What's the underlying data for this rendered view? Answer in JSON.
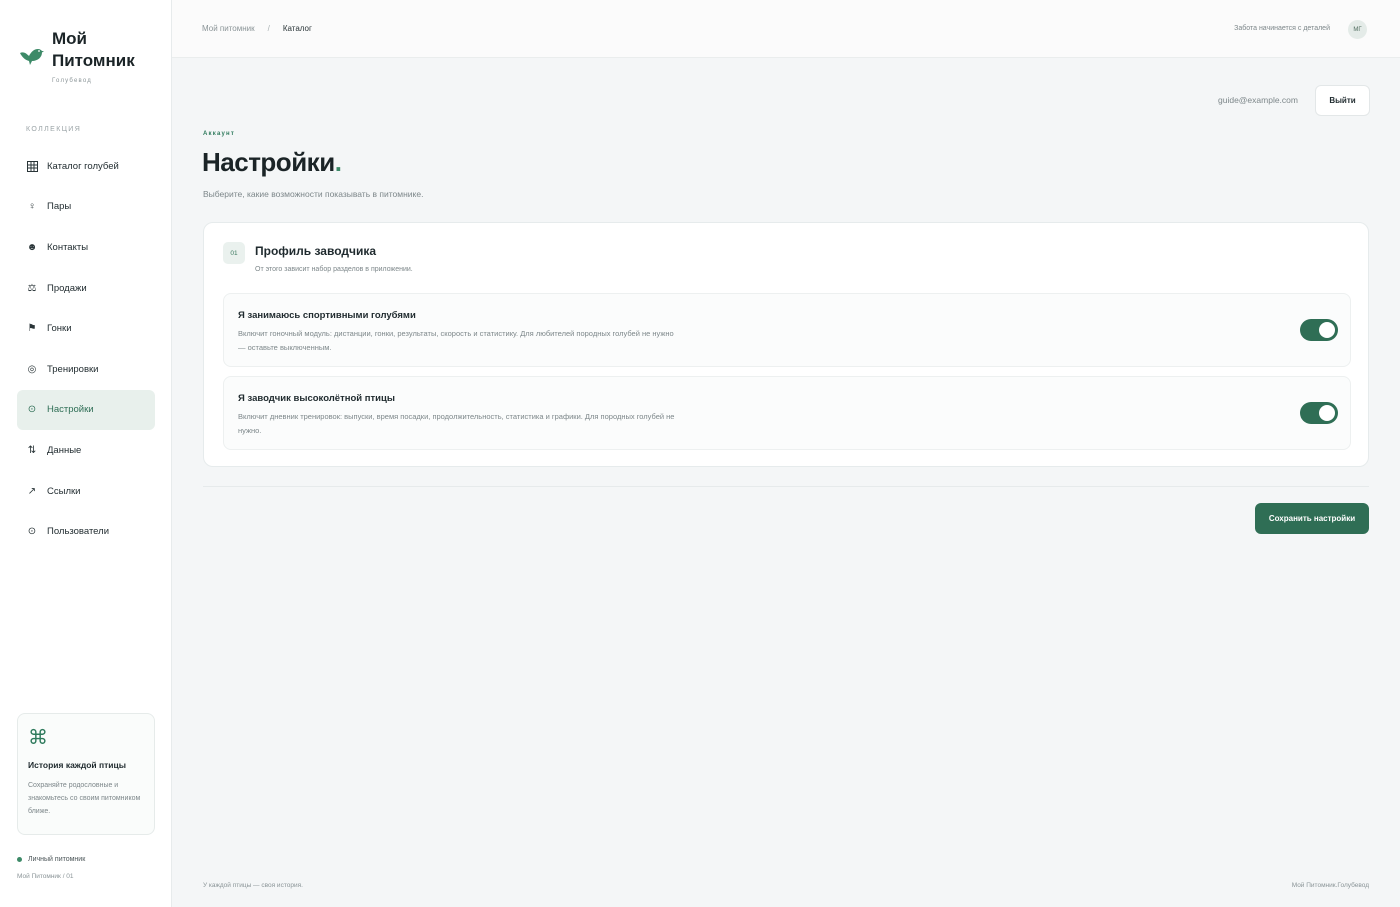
{
  "brand": {
    "title": "Мой Питомник",
    "subtitle": "Голубевод"
  },
  "sidebar": {
    "heading": "КОЛЛЕКЦИЯ",
    "items": [
      {
        "label": "Каталог голубей",
        "icon": "grid-icon"
      },
      {
        "label": "Пары",
        "icon": "female-symbol-icon"
      },
      {
        "label": "Контакты",
        "icon": "contacts-icon"
      },
      {
        "label": "Продажи",
        "icon": "scales-icon"
      },
      {
        "label": "Гонки",
        "icon": "flag-icon"
      },
      {
        "label": "Тренировки",
        "icon": "target-icon"
      },
      {
        "label": "Настройки",
        "icon": "settings-icon",
        "active": true
      },
      {
        "label": "Данные",
        "icon": "sort-arrows-icon"
      },
      {
        "label": "Ссылки",
        "icon": "link-arrow-icon"
      },
      {
        "label": "Пользователи",
        "icon": "users-icon"
      }
    ],
    "promo": {
      "icon": "command-icon",
      "title": "История каждой птицы",
      "text": "Сохраняйте родословные и знакомьтесь со своим питомником ближе."
    },
    "status": "Личный питомник",
    "version": "Мой Питомник / 01"
  },
  "topbar": {
    "crumbs": [
      "Мой питомник",
      "Каталог"
    ],
    "separator": "/",
    "tagline": "Забота начинается с деталей",
    "avatar": "МГ"
  },
  "account": {
    "email": "guide@example.com",
    "logout_label": "Выйти"
  },
  "page": {
    "eyebrow": "Аккаунт",
    "title": "Настройки",
    "title_dot": ".",
    "subtitle": "Выберите, какие возможности показывать в питомнике."
  },
  "section": {
    "number": "01",
    "title": "Профиль заводчика",
    "description": "От этого зависит набор разделов в приложении.",
    "options": [
      {
        "title": "Я занимаюсь спортивными голубями",
        "description": "Включит гоночный модуль: дистанции, гонки, результаты, скорость и статистику. Для любителей породных голубей не нужно — оставьте выключенным.",
        "enabled": true
      },
      {
        "title": "Я заводчик высоколётной птицы",
        "description": "Включит дневник тренировок: выпуски, время посадки, продолжительность, статистика и графики. Для породных голубей не нужно.",
        "enabled": true
      }
    ]
  },
  "actions": {
    "save_label": "Сохранить настройки"
  },
  "footer": {
    "left": "У каждой птицы — своя история.",
    "right": "Мой Питомник.Голубевод"
  },
  "colors": {
    "accent": "#2f6e55",
    "active_bg": "#e8f0ec",
    "background": "#f4f6f7"
  }
}
